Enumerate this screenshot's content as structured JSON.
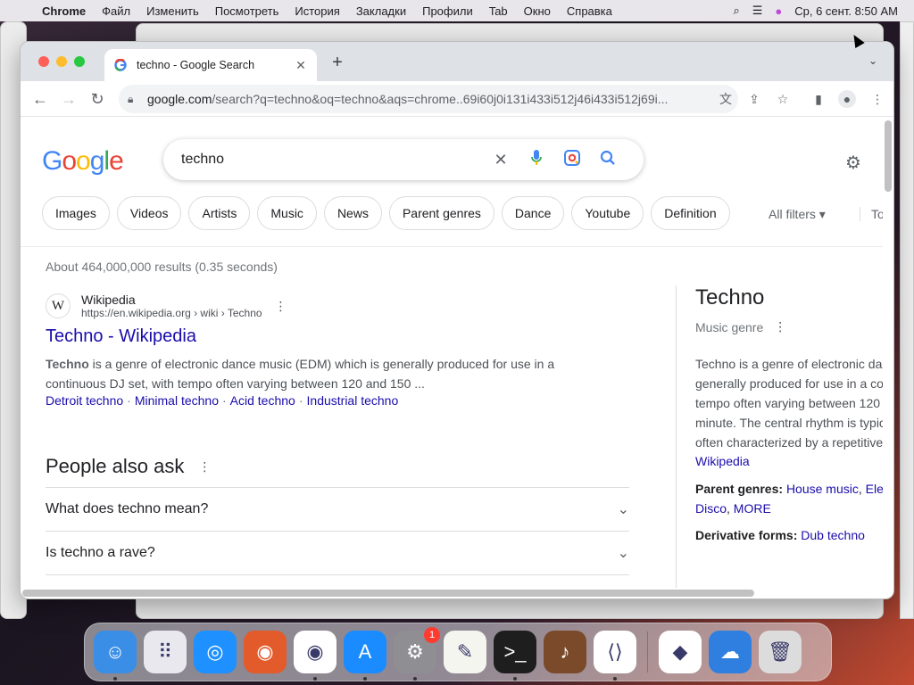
{
  "menubar": {
    "apple_icon": "apple-logo",
    "items": [
      "Chrome",
      "Файл",
      "Изменить",
      "Посмотреть",
      "История",
      "Закладки",
      "Профили",
      "Tab",
      "Окно",
      "Справка"
    ],
    "clock": "Ср, 6 сент.  8:50 AM"
  },
  "browser": {
    "tab_title": "techno - Google Search",
    "url_host": "google.com",
    "url_path": "/search?q=techno&oq=techno&aqs=chrome..69i60j0i131i433i512j46i433i512j69i..."
  },
  "google": {
    "logo": "Google",
    "logo_colors": [
      "#4285f4",
      "#ea4335",
      "#fbbc05",
      "#4285f4",
      "#34a853",
      "#ea4335"
    ],
    "query": "techno",
    "chips": [
      "Images",
      "Videos",
      "Artists",
      "Music",
      "News",
      "Parent genres",
      "Dance",
      "Youtube",
      "Definition"
    ],
    "all_filters": "All filters ▾",
    "tools": "Tools",
    "stats": "About 464,000,000 results (0.35 seconds)",
    "result": {
      "favicon_letter": "W",
      "site": "Wikipedia",
      "cite": "https://en.wikipedia.org › wiki › Techno",
      "title": "Techno - Wikipedia",
      "snippet_bold": "Techno",
      "snippet_rest": " is a genre of electronic dance music (EDM) which is generally produced for use in a continuous DJ set, with tempo often varying between 120 and 150 ...",
      "links": [
        "Detroit techno",
        "Minimal techno",
        "Acid techno",
        "Industrial techno"
      ]
    },
    "paa": {
      "heading": "People also ask",
      "questions": [
        "What does techno mean?",
        "Is techno a rave?"
      ]
    },
    "knowledge_panel": {
      "title": "Techno",
      "subtitle": "Music genre",
      "description_lines": [
        "Techno is a genre of electronic da",
        "generally produced for use in a co",
        "tempo often varying between 120",
        "minute. The central rhythm is typic",
        "often characterized by a repetitive"
      ],
      "source_link": "Wikipedia",
      "parent_label": "Parent genres:",
      "parent_values": [
        "House music",
        "Ele",
        "Disco",
        "MORE"
      ],
      "derivative_label": "Derivative forms:",
      "derivative_value": "Dub techno"
    }
  },
  "dock": {
    "apps": [
      {
        "name": "finder-icon",
        "color": "#3a8ee6",
        "glyph": "☺",
        "running": true
      },
      {
        "name": "launchpad-icon",
        "color": "#e8e8ee",
        "glyph": "⠿",
        "running": false
      },
      {
        "name": "safari-icon",
        "color": "#1e90ff",
        "glyph": "◎",
        "running": false
      },
      {
        "name": "firefox-icon",
        "color": "#e35a2b",
        "glyph": "◉",
        "running": false
      },
      {
        "name": "chrome-icon",
        "color": "#ffffff",
        "glyph": "◉",
        "running": true
      },
      {
        "name": "app-store-icon",
        "color": "#1a8cff",
        "glyph": "A",
        "running": true
      },
      {
        "name": "system-settings-icon",
        "color": "#8e8e93",
        "glyph": "⚙",
        "running": true,
        "badge": "1"
      },
      {
        "name": "textedit-icon",
        "color": "#f5f5f0",
        "glyph": "✎",
        "running": false
      },
      {
        "name": "terminal-icon",
        "color": "#1e1e1e",
        "glyph": ">_",
        "running": true
      },
      {
        "name": "garageband-icon",
        "color": "#7a4a2a",
        "glyph": "♪",
        "running": false
      },
      {
        "name": "vscode-icon",
        "color": "#ffffff",
        "glyph": "⟨⟩",
        "running": true
      }
    ],
    "recent": [
      {
        "name": "visual-studio-icon",
        "color": "#ffffff",
        "glyph": "◆",
        "running": false
      },
      {
        "name": "weather-icon",
        "color": "#2f7fe0",
        "glyph": "☁",
        "running": false
      },
      {
        "name": "trash-icon",
        "color": "#dcdcdc",
        "glyph": "🗑",
        "running": false
      }
    ]
  }
}
